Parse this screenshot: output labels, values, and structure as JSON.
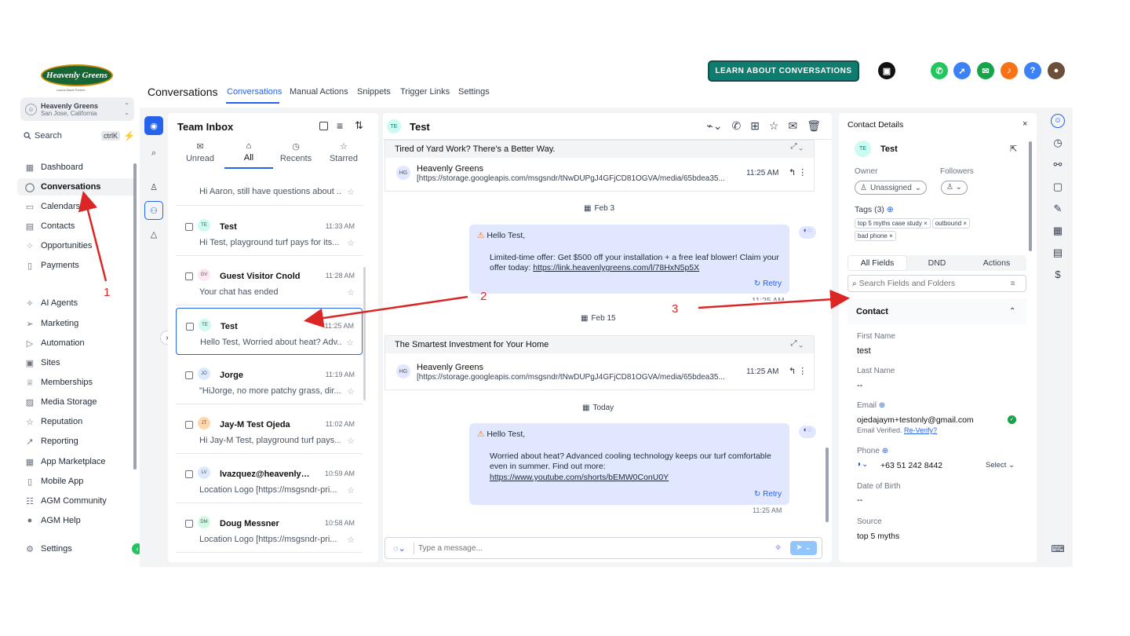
{
  "brand": {
    "logo_text": "Heavenly Greens",
    "logo_sub": "Lawns Made Perfect",
    "location_name": "Heavenly Greens",
    "location_city": "San Jose, California"
  },
  "sidebar": {
    "search_label": "Search",
    "search_kbd": "ctrlK",
    "items": [
      {
        "label": "Dashboard",
        "icon": "dashboard-icon"
      },
      {
        "label": "Conversations",
        "icon": "chat-icon"
      },
      {
        "label": "Calendars",
        "icon": "calendar-icon"
      },
      {
        "label": "Contacts",
        "icon": "contacts-icon"
      },
      {
        "label": "Opportunities",
        "icon": "opportunities-icon"
      },
      {
        "label": "Payments",
        "icon": "payments-icon"
      },
      {
        "label": "AI Agents",
        "icon": "ai-icon"
      },
      {
        "label": "Marketing",
        "icon": "send-icon"
      },
      {
        "label": "Automation",
        "icon": "automation-icon"
      },
      {
        "label": "Sites",
        "icon": "sites-icon"
      },
      {
        "label": "Memberships",
        "icon": "membership-icon"
      },
      {
        "label": "Media Storage",
        "icon": "media-icon"
      },
      {
        "label": "Reputation",
        "icon": "star-icon"
      },
      {
        "label": "Reporting",
        "icon": "chart-icon"
      },
      {
        "label": "App Marketplace",
        "icon": "apps-icon"
      },
      {
        "label": "Mobile App",
        "icon": "mobile-icon"
      },
      {
        "label": "AGM Community",
        "icon": "community-icon"
      },
      {
        "label": "AGM Help",
        "icon": "help-icon"
      }
    ],
    "settings_label": "Settings"
  },
  "header": {
    "title": "Conversations",
    "tabs": [
      "Conversations",
      "Manual Actions",
      "Snippets",
      "Trigger Links",
      "Settings"
    ],
    "learn_button": "LEARN ABOUT CONVERSATIONS"
  },
  "inbox": {
    "title": "Team Inbox",
    "tabs": [
      "Unread",
      "All",
      "Recents",
      "Starred"
    ],
    "partial_preview": "Hi Aaron, still have questions about ...",
    "conversations": [
      {
        "initials": "TE",
        "name": "Test",
        "time": "11:33 AM",
        "preview": "Hi Test, playground turf pays for its..."
      },
      {
        "initials": "GV",
        "name": "Guest Visitor Cnold",
        "time": "11:28 AM",
        "preview": "Your chat has ended"
      },
      {
        "initials": "TE",
        "name": "Test",
        "time": "11:25 AM",
        "preview": "Hello Test, Worried about heat? Adv..."
      },
      {
        "initials": "JO",
        "name": "Jorge",
        "time": "11:19 AM",
        "preview": "\"HiJorge, no more patchy grass, dir..."
      },
      {
        "initials": "JT",
        "name": "Jay-M Test Ojeda",
        "time": "11:02 AM",
        "preview": "Hi Jay-M Test, playground turf pays..."
      },
      {
        "initials": "LV",
        "name": "lvazquez@heavenlygre...",
        "time": "10:59 AM",
        "preview": "Location Logo [https://msgsndr-pri..."
      },
      {
        "initials": "DM",
        "name": "Doug Messner",
        "time": "10:58 AM",
        "preview": "Location Logo [https://msgsndr-pri..."
      }
    ]
  },
  "chat": {
    "contact_initials": "TE",
    "contact_name": "Test",
    "email1": {
      "subject": "Tired of Yard Work? There's a Better Way.",
      "from": "Heavenly Greens",
      "link": "[https://storage.googleapis.com/msgsndr/tNwDUPgJ4GFjCD81OGVA/media/65bdea35...",
      "time": "11:25 AM"
    },
    "date1": "Feb 3",
    "sms1": {
      "greeting": "Hello Test,",
      "body": "Limited-time offer: Get $500 off your installation + a free leaf blower! Claim your offer today: ",
      "link": "https://link.heavenlygreens.com/l/78HxN5p5X",
      "retry": "Retry",
      "time": "11:25 AM"
    },
    "date2": "Feb 15",
    "email2": {
      "subject": "The Smartest Investment for Your Home",
      "from": "Heavenly Greens",
      "link": "[https://storage.googleapis.com/msgsndr/tNwDUPgJ4GFjCD81OGVA/media/65bdea35...",
      "time": "11:25 AM"
    },
    "date3": "Today",
    "sms2": {
      "greeting": "Hello Test,",
      "body": "Worried about heat? Advanced cooling technology keeps our turf comfortable even in summer. Find out more:",
      "link": "https://www.youtube.com/shorts/bEMW0ConU0Y",
      "retry": "Retry",
      "time": "11:25 AM"
    },
    "composer_placeholder": "Type a message..."
  },
  "contact": {
    "title": "Contact Details",
    "initials": "TE",
    "name": "Test",
    "owner_label": "Owner",
    "owner_value": "Unassigned",
    "followers_label": "Followers",
    "tags_label": "Tags (3)",
    "tags": [
      "top 5 myths case study",
      "outbound",
      "bad phone"
    ],
    "tabs": [
      "All Fields",
      "DND",
      "Actions"
    ],
    "search_placeholder": "Search Fields and Folders",
    "section": "Contact",
    "first_name_label": "First Name",
    "first_name": "test",
    "last_name_label": "Last Name",
    "last_name": "--",
    "email_label": "Email",
    "email": "ojedajaym+testonly@gmail.com",
    "email_verified": "Email Verified.",
    "reverify": "Re-Verify?",
    "phone_label": "Phone",
    "phone": "+63 51 242 8442",
    "phone_select": "Select",
    "dob_label": "Date of Birth",
    "dob": "--",
    "source_label": "Source",
    "source": "top 5 myths"
  },
  "annotations": [
    "1",
    "2",
    "3"
  ],
  "colors": {
    "accent": "#2563eb",
    "learn_bg": "#0e7c6e",
    "arrow": "#dc2626",
    "bubble": "#e0e7ff"
  }
}
